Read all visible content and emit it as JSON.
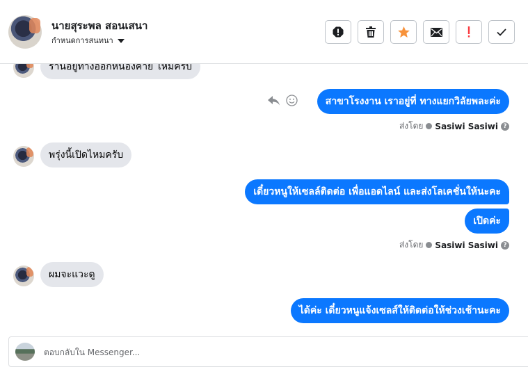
{
  "header": {
    "contact_name": "นายสุระพล สอนเสนา",
    "settings_label": "กำหนดการสนทนา",
    "toolbar": [
      {
        "name": "spam-icon",
        "color": "#1c1e21"
      },
      {
        "name": "trash-icon",
        "color": "#1c1e21"
      },
      {
        "name": "star-icon",
        "color": "#f7923b"
      },
      {
        "name": "mail-icon",
        "color": "#1c1e21"
      },
      {
        "name": "important-icon",
        "color": "#fa383e"
      },
      {
        "name": "check-icon",
        "color": "#1c1e21"
      }
    ]
  },
  "messages": [
    {
      "dir": "in",
      "text": "ร้านอยู่ทางออกหนองคาย ไหมครับ"
    },
    {
      "dir": "out",
      "text": "สาขาโรงงาน เราอยู่ที่ ทางแยกวิลัยพละค่ะ"
    },
    {
      "dir": "in",
      "text": "พรุ่งนี้เปิดไหมครับ"
    },
    {
      "dir": "out",
      "text": "เดี๋ยวหนูให้เซลล์ติดต่อ เพื่อแอดไลน์ และส่งโลเคชั่นให้นะคะ"
    },
    {
      "dir": "out",
      "text": "เปิดค่ะ"
    },
    {
      "dir": "in",
      "text": "ผมจะแวะดู"
    },
    {
      "dir": "out",
      "text": "ได้ค่ะ เดี๋ยวหนูแจ้งเซลส์ให้ติดต่อให้ช่วงเช้านะคะ"
    }
  ],
  "sent_by": {
    "label": "ส่งโดย",
    "name": "Sasiwi Sasiwi"
  },
  "composer": {
    "placeholder": "ตอบกลับใน Messenger..."
  },
  "colors": {
    "outgoing_bubble": "#0b78ff",
    "incoming_bubble": "#e4e6eb"
  }
}
